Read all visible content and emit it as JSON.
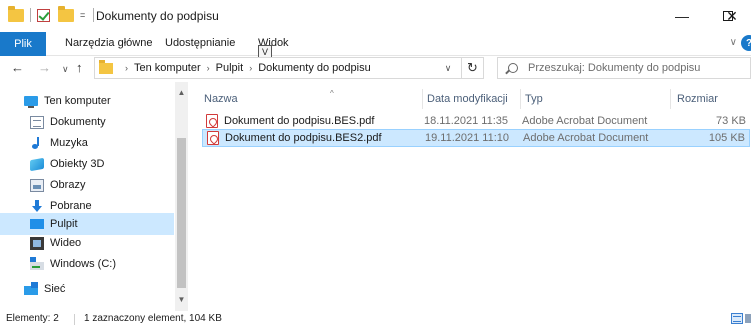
{
  "window": {
    "title": "Dokumenty do podpisu",
    "min_icon": "—",
    "close_icon": "✕"
  },
  "quick_access": {
    "dropdown": "="
  },
  "ribbon": {
    "file_tab": "Plik",
    "tabs": [
      "Narzędzia główne",
      "Udostępnianie",
      "Widok"
    ],
    "keytip": "V",
    "expand_icon": "∨",
    "help_icon": "?"
  },
  "nav": {
    "back": "←",
    "forward": "→",
    "recent": "∨",
    "up": "↑",
    "breadcrumb": [
      "Ten komputer",
      "Pulpit",
      "Dokumenty do podpisu"
    ],
    "crumb_separator": "›",
    "refresh": "↻",
    "dropdown": "∨",
    "search_placeholder": "Przeszukaj: Dokumenty do podpisu"
  },
  "sidebar": {
    "items": [
      {
        "label": "Ten komputer",
        "icon": "computer-icon",
        "selected": false
      },
      {
        "label": "Dokumenty",
        "icon": "documents-icon",
        "selected": false
      },
      {
        "label": "Muzyka",
        "icon": "music-icon",
        "selected": false
      },
      {
        "label": "Obiekty 3D",
        "icon": "3d-objects-icon",
        "selected": false
      },
      {
        "label": "Obrazy",
        "icon": "pictures-icon",
        "selected": false
      },
      {
        "label": "Pobrane",
        "icon": "downloads-icon",
        "selected": false
      },
      {
        "label": "Pulpit",
        "icon": "desktop-icon",
        "selected": true
      },
      {
        "label": "Wideo",
        "icon": "video-icon",
        "selected": false
      },
      {
        "label": "Windows (C:)",
        "icon": "drive-icon",
        "selected": false
      },
      {
        "label": "Sieć",
        "icon": "network-icon",
        "selected": false
      }
    ],
    "scroll_up": "▲",
    "scroll_down": "▼"
  },
  "files": {
    "columns": [
      "Nazwa",
      "Data modyfikacji",
      "Typ",
      "Rozmiar"
    ],
    "sort_arrow": "^",
    "rows": [
      {
        "name": "Dokument do podpisu.BES.pdf",
        "date": "18.11.2021 11:35",
        "type": "Adobe Acrobat Document",
        "size": "73 KB",
        "selected": false
      },
      {
        "name": "Dokument do podpisu.BES2.pdf",
        "date": "19.11.2021 11:10",
        "type": "Adobe Acrobat Document",
        "size": "105 KB",
        "selected": true
      }
    ]
  },
  "status": {
    "count": "Elementy: 2",
    "selection": "1 zaznaczony element, 104 KB"
  },
  "colors": {
    "accent": "#1979ca",
    "selection": "#cce8ff"
  }
}
